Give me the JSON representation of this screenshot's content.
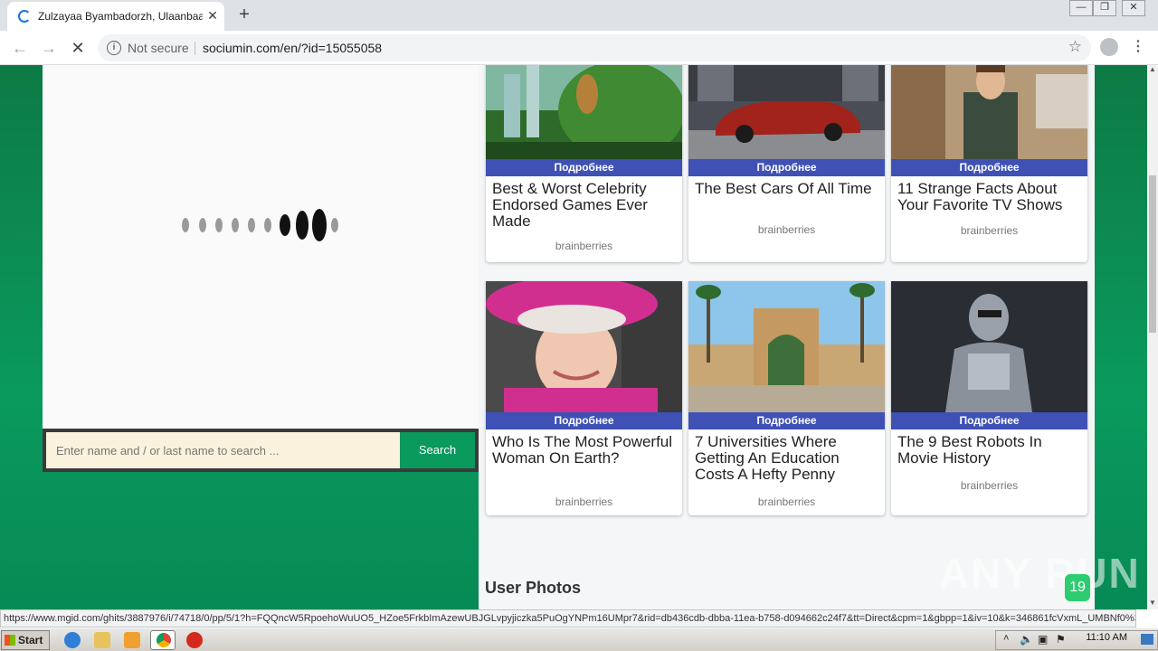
{
  "browser": {
    "tab_title": "Zulzayaa Byambadorzh, Ulaanbaatar",
    "security_label": "Not secure",
    "url": "sociumin.com/en/?id=15055058",
    "status_url": "https://www.mgid.com/ghits/3887976/i/74718/0/pp/5/1?h=FQQncW5RpoehoWuUO5_HZoe5FrkbImAzewUBJGLvpyjiczka5PuOgYNPm16UMpr7&rid=db436cdb-dbba-11ea-b758-d094662c24f7&tt=Direct&cpm=1&gbpp=1&iv=10&k=346861fcVxmL_UMBNf0%3..."
  },
  "search": {
    "placeholder": "Enter name and / or last name to search ...",
    "button_label": "Search"
  },
  "cards": [
    {
      "banner": "Подробнее",
      "title": "Best & Worst Celebrity Endorsed Games Ever Made",
      "source": "brainberries",
      "image": "jungle-game-scene"
    },
    {
      "banner": "Подробнее",
      "title": "The Best Cars Of All Time",
      "source": "brainberries",
      "image": "red-car"
    },
    {
      "banner": "Подробнее",
      "title": "11 Strange Facts About Your Favorite TV Shows",
      "source": "brainberries",
      "image": "man-in-kitchen"
    },
    {
      "banner": "Подробнее",
      "title": "Who Is The Most Powerful Woman On Earth?",
      "source": "brainberries",
      "image": "queen-pink-hat"
    },
    {
      "banner": "Подробнее",
      "title": "7 Universities Where Getting An Education Costs A Hefty Penny",
      "source": "brainberries",
      "image": "university-arch"
    },
    {
      "banner": "Подробнее",
      "title": "The 9 Best Robots In Movie History",
      "source": "brainberries",
      "image": "robocop"
    }
  ],
  "section_title": "User Photos",
  "badge_count": "19",
  "watermark": "ANY RUN",
  "taskbar": {
    "start_label": "Start",
    "clock": "11:10 AM"
  }
}
